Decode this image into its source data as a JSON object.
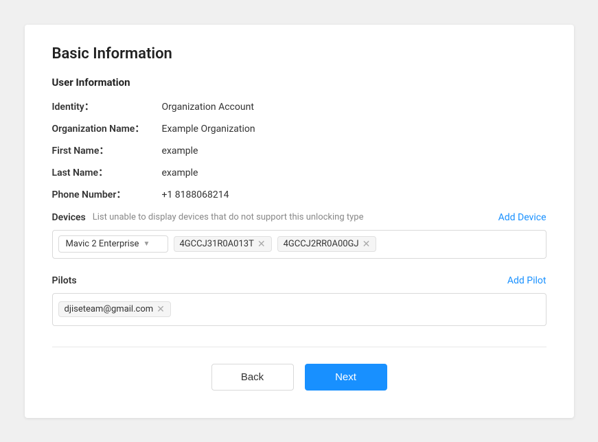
{
  "card": {
    "section_title": "Basic Information",
    "user_info": {
      "sub_title": "User Information",
      "identity_label": "Identity：",
      "identity_value": "Organization Account",
      "org_name_label": "Organization Name：",
      "org_name_value": "Example Organization",
      "first_name_label": "First Name：",
      "first_name_value": "example",
      "last_name_label": "Last Name：",
      "last_name_value": "example",
      "phone_label": "Phone Number：",
      "phone_value": "+1 8188068214"
    },
    "devices": {
      "label": "Devices",
      "note": "List unable to display devices that do not support this unlocking type",
      "add_link": "Add Device",
      "select_value": "Mavic 2 Enterprise",
      "tags": [
        {
          "id": "tag-1",
          "value": "4GCCJ31R0A013T"
        },
        {
          "id": "tag-2",
          "value": "4GCCJ2RR0A00GJ"
        }
      ]
    },
    "pilots": {
      "label": "Pilots",
      "add_link": "Add Pilot",
      "tags": [
        {
          "id": "pilot-1",
          "value": "djiseteam@gmail.com"
        }
      ]
    },
    "footer": {
      "back_label": "Back",
      "next_label": "Next"
    }
  }
}
